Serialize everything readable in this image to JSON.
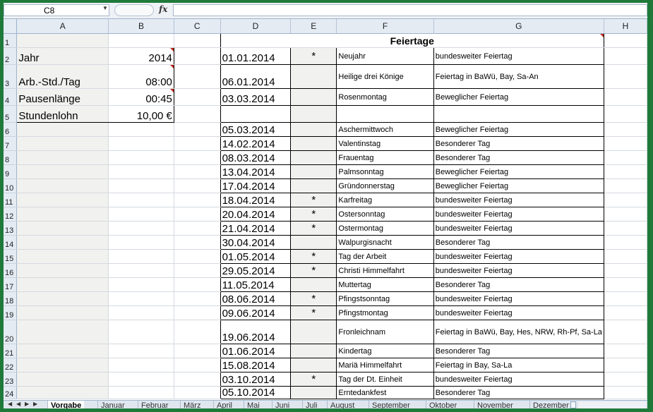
{
  "formula_bar": {
    "name_box": "C8",
    "fx": "fx",
    "formula": ""
  },
  "columns": [
    "A",
    "B",
    "C",
    "D",
    "E",
    "F",
    "G",
    "H"
  ],
  "rows": [
    "1",
    "2",
    "3",
    "4",
    "5",
    "6",
    "7",
    "8",
    "9",
    "10",
    "11",
    "12",
    "13",
    "14",
    "15",
    "16",
    "17",
    "18",
    "19",
    "20",
    "21",
    "22",
    "23",
    "24"
  ],
  "settings": [
    {
      "label": "Jahr",
      "value": "2014"
    },
    {
      "label": "Arb.-Std./Tag",
      "value": "08:00"
    },
    {
      "label": "Pausenlänge",
      "value": "00:45"
    },
    {
      "label": "Stundenlohn",
      "value": "10,00 €"
    }
  ],
  "holidays_title": "Feiertage",
  "holidays": [
    {
      "date": "01.01.2014",
      "mark": "*",
      "name": "Neujahr",
      "type": "bundesweiter Feiertag"
    },
    {
      "date": "06.01.2014",
      "mark": "",
      "name": "Heilige drei Könige",
      "type": "Feiertag in BaWü, Bay, Sa-An"
    },
    {
      "date": "03.03.2014",
      "mark": "",
      "name": "Rosenmontag",
      "type": "Beweglicher Feiertag"
    },
    {
      "date": "",
      "mark": "",
      "name": "",
      "type": ""
    },
    {
      "date": "05.03.2014",
      "mark": "",
      "name": "Aschermittwoch",
      "type": "Beweglicher Feiertag"
    },
    {
      "date": "14.02.2014",
      "mark": "",
      "name": "Valentinstag",
      "type": "Besonderer Tag"
    },
    {
      "date": "08.03.2014",
      "mark": "",
      "name": "Frauentag",
      "type": "Besonderer Tag"
    },
    {
      "date": "13.04.2014",
      "mark": "",
      "name": "Palmsonntag",
      "type": "Beweglicher Feiertag"
    },
    {
      "date": "17.04.2014",
      "mark": "",
      "name": "Gründonnerstag",
      "type": "Beweglicher Feiertag"
    },
    {
      "date": "18.04.2014",
      "mark": "*",
      "name": "Karfreitag",
      "type": "bundesweiter Feiertag"
    },
    {
      "date": "20.04.2014",
      "mark": "*",
      "name": "Ostersonntag",
      "type": "bundesweiter Feiertag"
    },
    {
      "date": "21.04.2014",
      "mark": "*",
      "name": "Ostermontag",
      "type": "bundesweiter Feiertag"
    },
    {
      "date": "30.04.2014",
      "mark": "",
      "name": "Walpurgisnacht",
      "type": "Besonderer Tag"
    },
    {
      "date": "01.05.2014",
      "mark": "*",
      "name": "Tag der Arbeit",
      "type": "bundesweiter Feiertag"
    },
    {
      "date": "29.05.2014",
      "mark": "*",
      "name": "Christi Himmelfahrt",
      "type": "bundesweiter Feiertag"
    },
    {
      "date": "11.05.2014",
      "mark": "",
      "name": "Muttertag",
      "type": "Besonderer Tag"
    },
    {
      "date": "08.06.2014",
      "mark": "*",
      "name": "Pfingstsonntag",
      "type": "bundesweiter Feiertag"
    },
    {
      "date": "09.06.2014",
      "mark": "*",
      "name": "Pfingstmontag",
      "type": "bundesweiter Feiertag"
    },
    {
      "date": "19.06.2014",
      "mark": "",
      "name": "Fronleichnam",
      "type": "Feiertag in BaWü, Bay, Hes, NRW, Rh-Pf, Sa-La"
    },
    {
      "date": "01.06.2014",
      "mark": "",
      "name": "Kindertag",
      "type": "Besonderer Tag"
    },
    {
      "date": "15.08.2014",
      "mark": "",
      "name": "Mariä Himmelfahrt",
      "type": "Feiertag in Bay, Sa-La"
    },
    {
      "date": "03.10.2014",
      "mark": "*",
      "name": "Tag der Dt. Einheit",
      "type": "bundesweiter Feiertag"
    },
    {
      "date": "05.10.2014",
      "mark": "",
      "name": "Erntedankfest",
      "type": "Besonderer Tag"
    }
  ],
  "sheet_tabs": [
    "Vorgabe",
    "Januar",
    "Februar",
    "März",
    "April",
    "Mai",
    "Juni",
    "Juli",
    "August",
    "September",
    "Oktober",
    "November",
    "Dezember"
  ],
  "active_tab": "Vorgabe"
}
